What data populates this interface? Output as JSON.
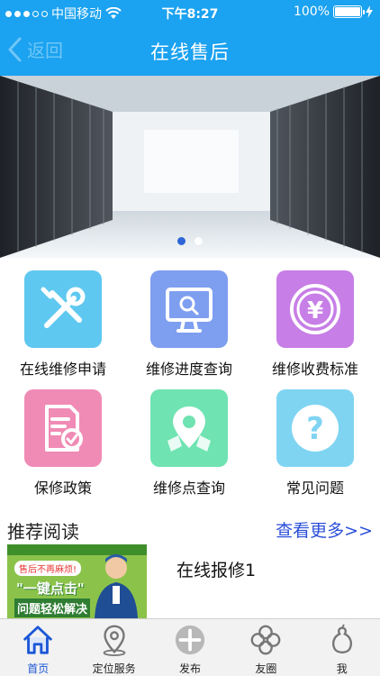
{
  "status_bar": {
    "carrier": "中国移动",
    "time": "下午8:27",
    "battery": "100%"
  },
  "nav": {
    "back_label": "返回",
    "title": "在线售后"
  },
  "banner": {
    "pages": 2,
    "active_index": 0
  },
  "services": [
    {
      "label": "在线维修申请",
      "icon": "tools-icon",
      "color": "#5fc8f0"
    },
    {
      "label": "维修进度查询",
      "icon": "monitor-search-icon",
      "color": "#7e9ef0"
    },
    {
      "label": "维修收费标准",
      "icon": "yen-coin-icon",
      "color": "#c77ee6"
    },
    {
      "label": "保修政策",
      "icon": "document-check-icon",
      "color": "#f08bb5"
    },
    {
      "label": "维修点查询",
      "icon": "map-pin-icon",
      "color": "#6fe3b2"
    },
    {
      "label": "常见问题",
      "icon": "question-icon",
      "color": "#7fd4f2"
    }
  ],
  "recommend": {
    "title": "推荐阅读",
    "more": "查看更多>>"
  },
  "article": {
    "title": "在线报修1",
    "thumb_tag": "售后不再麻烦!",
    "thumb_headline": "\"一键点击\"",
    "thumb_sub": "问题轻松解决"
  },
  "tabs": [
    {
      "label": "首页",
      "icon": "home-icon",
      "active": true
    },
    {
      "label": "定位服务",
      "icon": "location-icon",
      "active": false
    },
    {
      "label": "发布",
      "icon": "plus-icon",
      "active": false
    },
    {
      "label": "友圈",
      "icon": "clover-icon",
      "active": false
    },
    {
      "label": "我",
      "icon": "gourd-icon",
      "active": false
    }
  ],
  "colors": {
    "primary": "#1ba2f0",
    "accent": "#1a56d6",
    "link": "#2b4fd8"
  }
}
